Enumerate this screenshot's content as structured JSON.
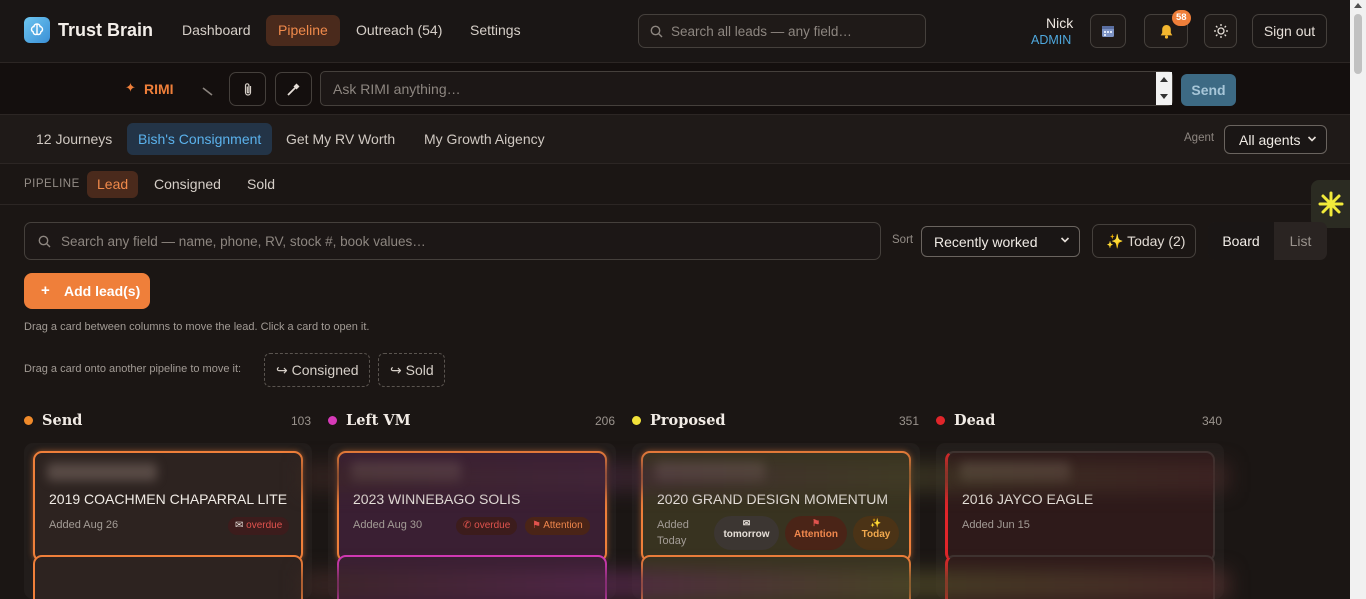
{
  "app": {
    "name": "Trust Brain"
  },
  "nav": {
    "dashboard": "Dashboard",
    "pipeline": "Pipeline",
    "outreach": "Outreach (54)",
    "settings": "Settings"
  },
  "global_search": {
    "placeholder": "Search all leads — any field…"
  },
  "user": {
    "name": "Nick",
    "role": "ADMIN"
  },
  "notifications": {
    "count": "58"
  },
  "signout": "Sign out",
  "rimi": {
    "label": "RIMI",
    "placeholder": "Ask RIMI anything…",
    "send": "Send"
  },
  "journeys": {
    "items": [
      "12 Journeys",
      "Bish's Consignment",
      "Get My RV Worth",
      "My Growth Aigency"
    ],
    "active": "Bish's Consignment",
    "agent_label": "Agent",
    "agent_value": "All agents"
  },
  "pipeline": {
    "label": "PIPELINE",
    "tabs": [
      "Lead",
      "Consigned",
      "Sold"
    ],
    "active": "Lead"
  },
  "filters": {
    "search_placeholder": "Search any field — name, phone, RV, stock #, book values…",
    "sort_label": "Sort",
    "sort_value": "Recently worked",
    "today": "Today (2)",
    "view_board": "Board",
    "view_list": "List"
  },
  "actions": {
    "add_lead": "Add lead(s)",
    "plus": "+"
  },
  "hints": {
    "drag_columns": "Drag a card between columns to move the lead. Click a card to open it.",
    "drag_pipeline": "Drag a card onto another pipeline to move it:",
    "move_consigned": "Consigned",
    "move_sold": "Sold"
  },
  "columns": [
    {
      "title": "Send",
      "count": "103",
      "color": "#f08a2a",
      "card": {
        "title": "2019 COACHMEN CHAPARRAL LITE",
        "added": "Added Aug 26",
        "chips": [
          "overdue"
        ]
      }
    },
    {
      "title": "Left VM",
      "count": "206",
      "color": "#d63ab8",
      "card": {
        "title": "2023 WINNEBAGO SOLIS",
        "added": "Added Aug 30",
        "chips": [
          "overdue",
          "Attention"
        ]
      }
    },
    {
      "title": "Proposed",
      "count": "351",
      "color": "#f2e23a",
      "card": {
        "title": "2020 GRAND DESIGN MOMENTUM",
        "added_1": "Added",
        "added_2": "Today",
        "chips": [
          "tomorrow",
          "Attention",
          "Today"
        ]
      }
    },
    {
      "title": "Dead",
      "count": "340",
      "color": "#e0252a",
      "card": {
        "title": "2016 JAYCO EAGLE",
        "added": "Added Jun 15",
        "chips": []
      }
    }
  ],
  "colors": {
    "accent": "#ef7f3a",
    "link": "#4fa8dd",
    "background": "#1b1614"
  }
}
